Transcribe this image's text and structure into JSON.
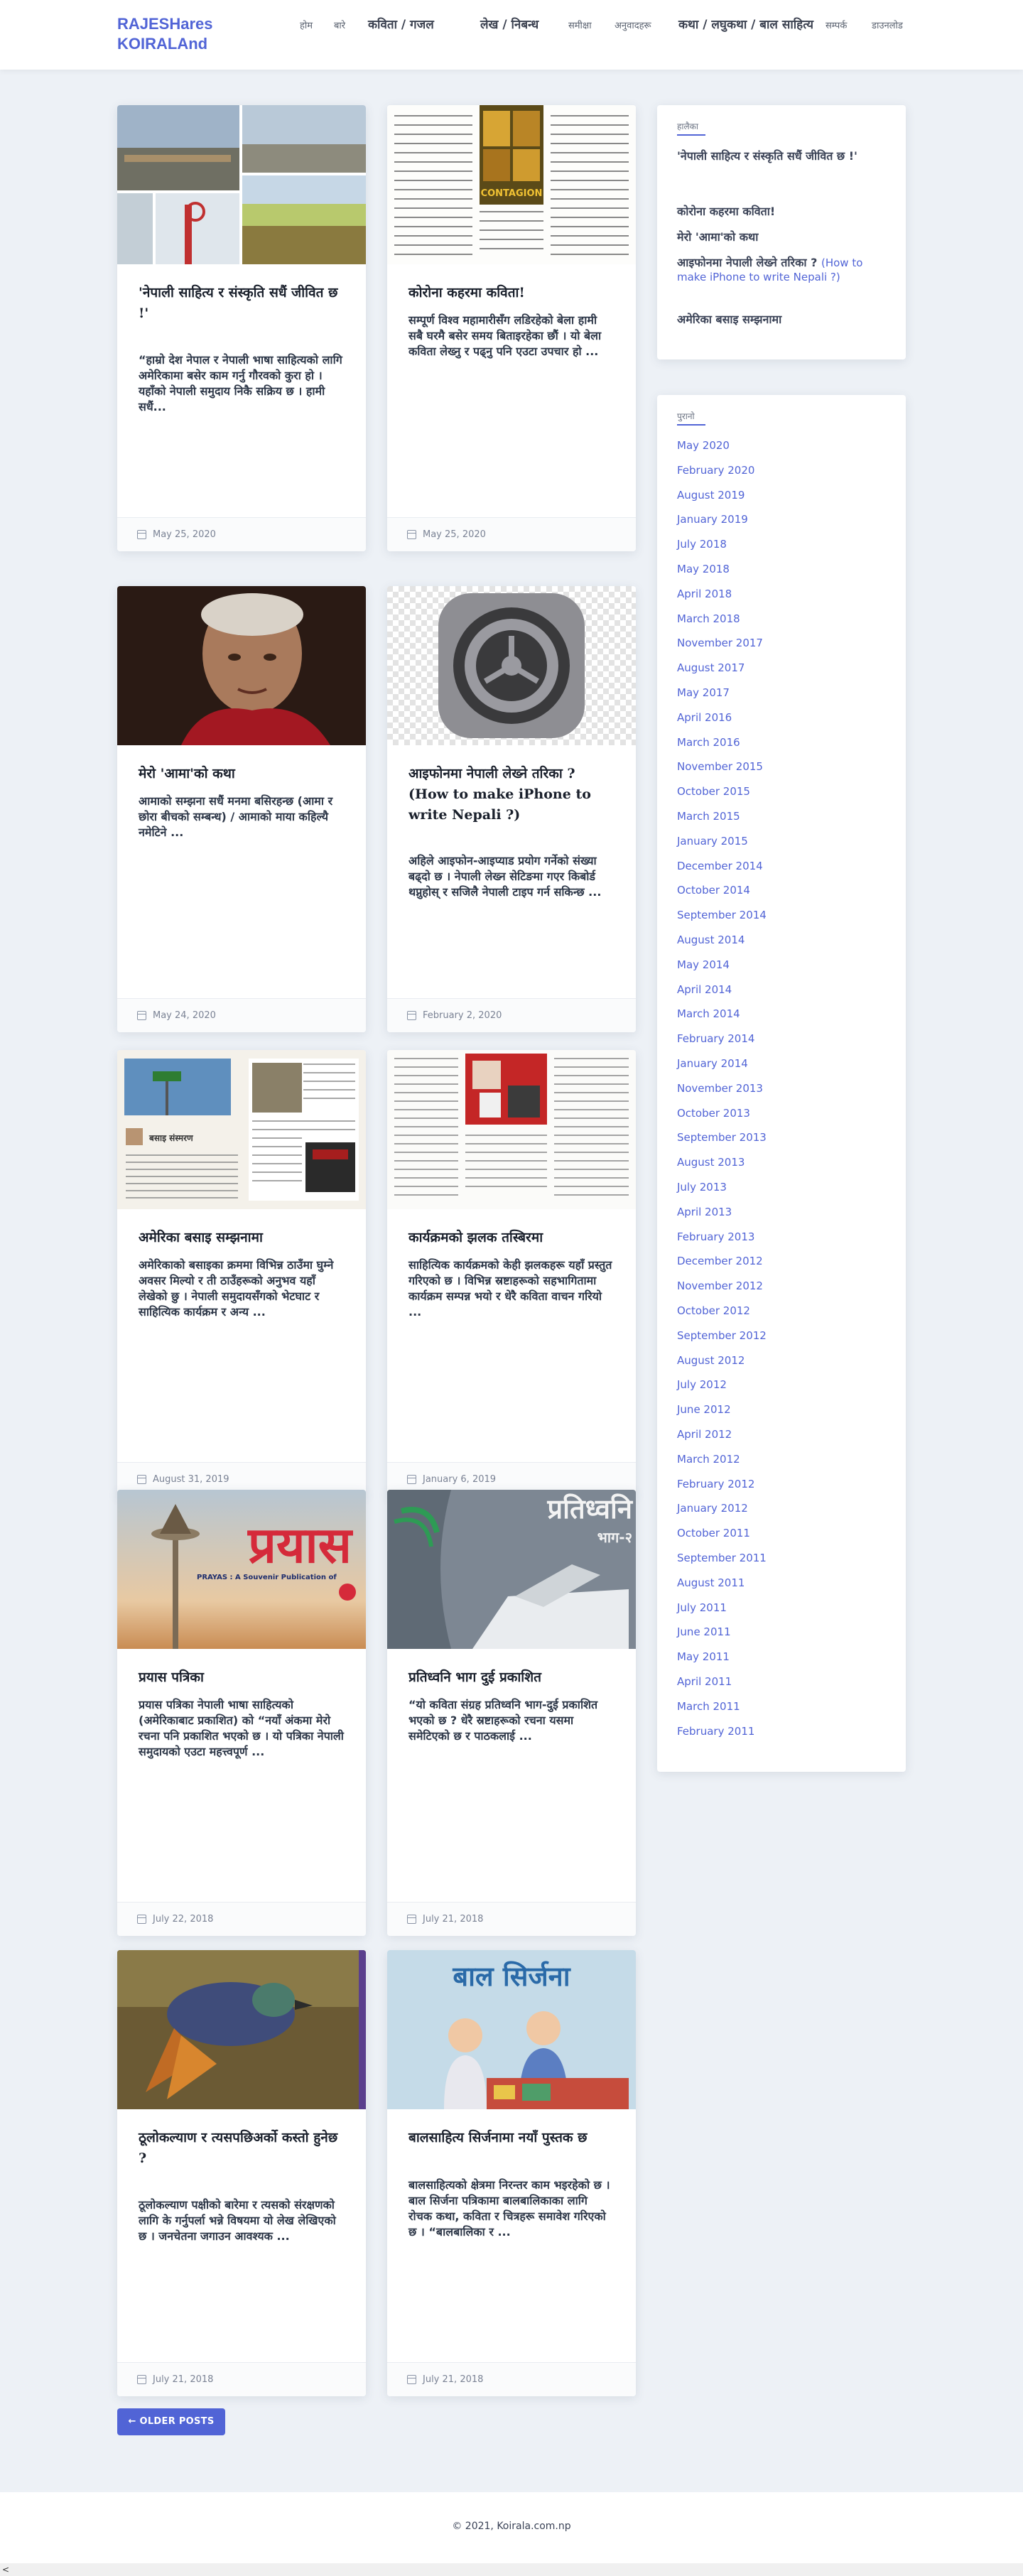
{
  "site": {
    "title": "RAJESHares KOIRALAnd"
  },
  "nav": {
    "items": [
      "होम",
      "बारे",
      "कविता / गजल",
      "लेख / निबन्ध",
      "समीक्षा",
      "अनुवादहरू",
      "कथा / लघुकथा / बाल साहित्य",
      "सम्पर्क",
      "डाउनलोड"
    ]
  },
  "posts": [
    {
      "title": "'नेपाली साहित्य र संस्कृति सधैं जीवित छ !'",
      "excerpt": "“हाम्रो देश नेपाल र नेपाली भाषा साहित्यको लागि अमेरिकामा बसेर काम गर्नु गौरवको कुरा हो । यहाँको नेपाली समुदाय निकै सक्रिय छ । हामी सधैं...",
      "date": "May 25, 2020"
    },
    {
      "title": "कोरोना कहरमा कविता!",
      "excerpt": "सम्पूर्ण विश्व महामारीसँग लडिरहेको बेला हामी सबै घरमै बसेर समय बिताइरहेका छौं । यो बेला कविता लेख्नु र पढ्नु पनि एउटा उपचार हो ...",
      "date": "May 25, 2020"
    },
    {
      "title": "मेरो 'आमा'को कथा",
      "excerpt": "आमाको सम्झना सधैं मनमा बसिरहन्छ (आमा र छोरा बीचको सम्बन्ध) / आमाको माया कहिल्यै नमेटिने ...",
      "date": "May 24, 2020"
    },
    {
      "title": "आइफोनमा नेपाली लेख्ने तरिका ? (How to make iPhone to write Nepali ?)",
      "excerpt": "अहिले आइफोन-आइप्याड प्रयोग गर्नेको संख्या बढ्दो छ । नेपाली लेख्न सेटिङमा गएर किबोर्ड थप्नुहोस् र सजिलै नेपाली टाइप गर्न सकिन्छ ...",
      "date": "February 2, 2020"
    },
    {
      "title": "अमेरिका बसाइ सम्झनामा",
      "excerpt": "अमेरिकाको बसाइका क्रममा विभिन्न ठाउँमा घुम्ने अवसर मिल्यो र ती ठाउँहरूको अनुभव यहाँ लेखेको छु । नेपाली समुदायसँगको भेटघाट र साहित्यिक कार्यक्रम र अन्य ...",
      "date": "August 31, 2019"
    },
    {
      "title": "कार्यक्रमको झलक तस्बिरमा",
      "excerpt": "साहित्यिक कार्यक्रमको केही झलकहरू यहाँ प्रस्तुत गरिएको छ । विभिन्न स्रष्टाहरूको सहभागितामा कार्यक्रम सम्पन्न भयो र धेरै कविता वाचन गरियो ...",
      "date": "January 6, 2019"
    },
    {
      "title": "प्रयास पत्रिका",
      "excerpt": "प्रयास पत्रिका नेपाली भाषा साहित्यको (अमेरिकाबाट प्रकाशित) को “नयाँ अंकमा मेरो रचना पनि प्रकाशित भएको छ । यो पत्रिका नेपाली समुदायको एउटा महत्त्वपूर्ण ...",
      "date": "July 22, 2018"
    },
    {
      "title": "प्रतिध्वनि भाग दुई प्रकाशित",
      "excerpt": "“यो कविता संग्रह प्रतिध्वनि भाग-दुई प्रकाशित भएको छ ? धेरै स्रष्टाहरूको रचना यसमा समेटिएको छ र पाठकलाई ...",
      "date": "July 21, 2018"
    },
    {
      "title": "ठूलोकल्याण र त्यसपछिअर्को कस्तो हुनेछ ?",
      "excerpt": "ठूलोकल्याण पक्षीको बारेमा र त्यसको संरक्षणको लागि के गर्नुपर्ला भन्ने विषयमा यो लेख लेखिएको छ । जनचेतना जगाउन आवश्यक ...",
      "date": "July 21, 2018"
    },
    {
      "title": "बालसाहित्य सिर्जनामा नयाँ पुस्तक छ",
      "excerpt": "बालसाहित्यको क्षेत्रमा निरन्तर काम भइरहेको छ । बाल सिर्जना पत्रिकामा बालबालिकाका लागि रोचक कथा, कविता र चित्रहरू समावेश गरिएको छ । “बालबालिका र ...",
      "date": "July 21, 2018"
    }
  ],
  "sidebar": {
    "recent_title": "हालैका",
    "recent_posts": [
      {
        "np": "'नेपाली साहित्य र संस्कृति सधैं जीवित छ !'",
        "en": ""
      },
      {
        "np": "कोरोना कहरमा कविता!",
        "en": ""
      },
      {
        "np": "मेरो 'आमा'को कथा",
        "en": ""
      },
      {
        "np": "आइफोनमा नेपाली लेख्ने तरिका ?",
        "en": "(How to make iPhone to write Nepali ?)"
      },
      {
        "np": "अमेरिका बसाइ सम्झनामा",
        "en": ""
      }
    ],
    "archives_title": "पुरानो",
    "archives": [
      "May 2020",
      "February 2020",
      "August 2019",
      "January 2019",
      "July 2018",
      "May 2018",
      "April 2018",
      "March 2018",
      "November 2017",
      "August 2017",
      "May 2017",
      "April 2016",
      "March 2016",
      "November 2015",
      "October 2015",
      "March 2015",
      "January 2015",
      "December 2014",
      "October 2014",
      "September 2014",
      "August 2014",
      "May 2014",
      "April 2014",
      "March 2014",
      "February 2014",
      "January 2014",
      "November 2013",
      "October 2013",
      "September 2013",
      "August 2013",
      "July 2013",
      "April 2013",
      "February 2013",
      "December 2012",
      "November 2012",
      "October 2012",
      "September 2012",
      "August 2012",
      "July 2012",
      "June 2012",
      "April 2012",
      "March 2012",
      "February 2012",
      "January 2012",
      "October 2011",
      "September 2011",
      "August 2011",
      "July 2011",
      "June 2011",
      "May 2011",
      "April 2011",
      "March 2011",
      "February 2011"
    ]
  },
  "pagination": {
    "older_label": "← OLDER POSTS"
  },
  "footer": {
    "copyright": "© 2021, Koirala.com.np"
  },
  "thumb_text": {
    "contagion": "CONTAGION",
    "prayas": "प्रयास",
    "prayas_sub": "PRAYAS : A Souvenir Publication of",
    "pratidhwani": "प्रतिध्वनि",
    "pratidhwani_sub": "भाग-२",
    "bal": "बाल सिर्जना"
  },
  "colors": {
    "accent": "#5164d6",
    "background": "#edf1f6"
  }
}
